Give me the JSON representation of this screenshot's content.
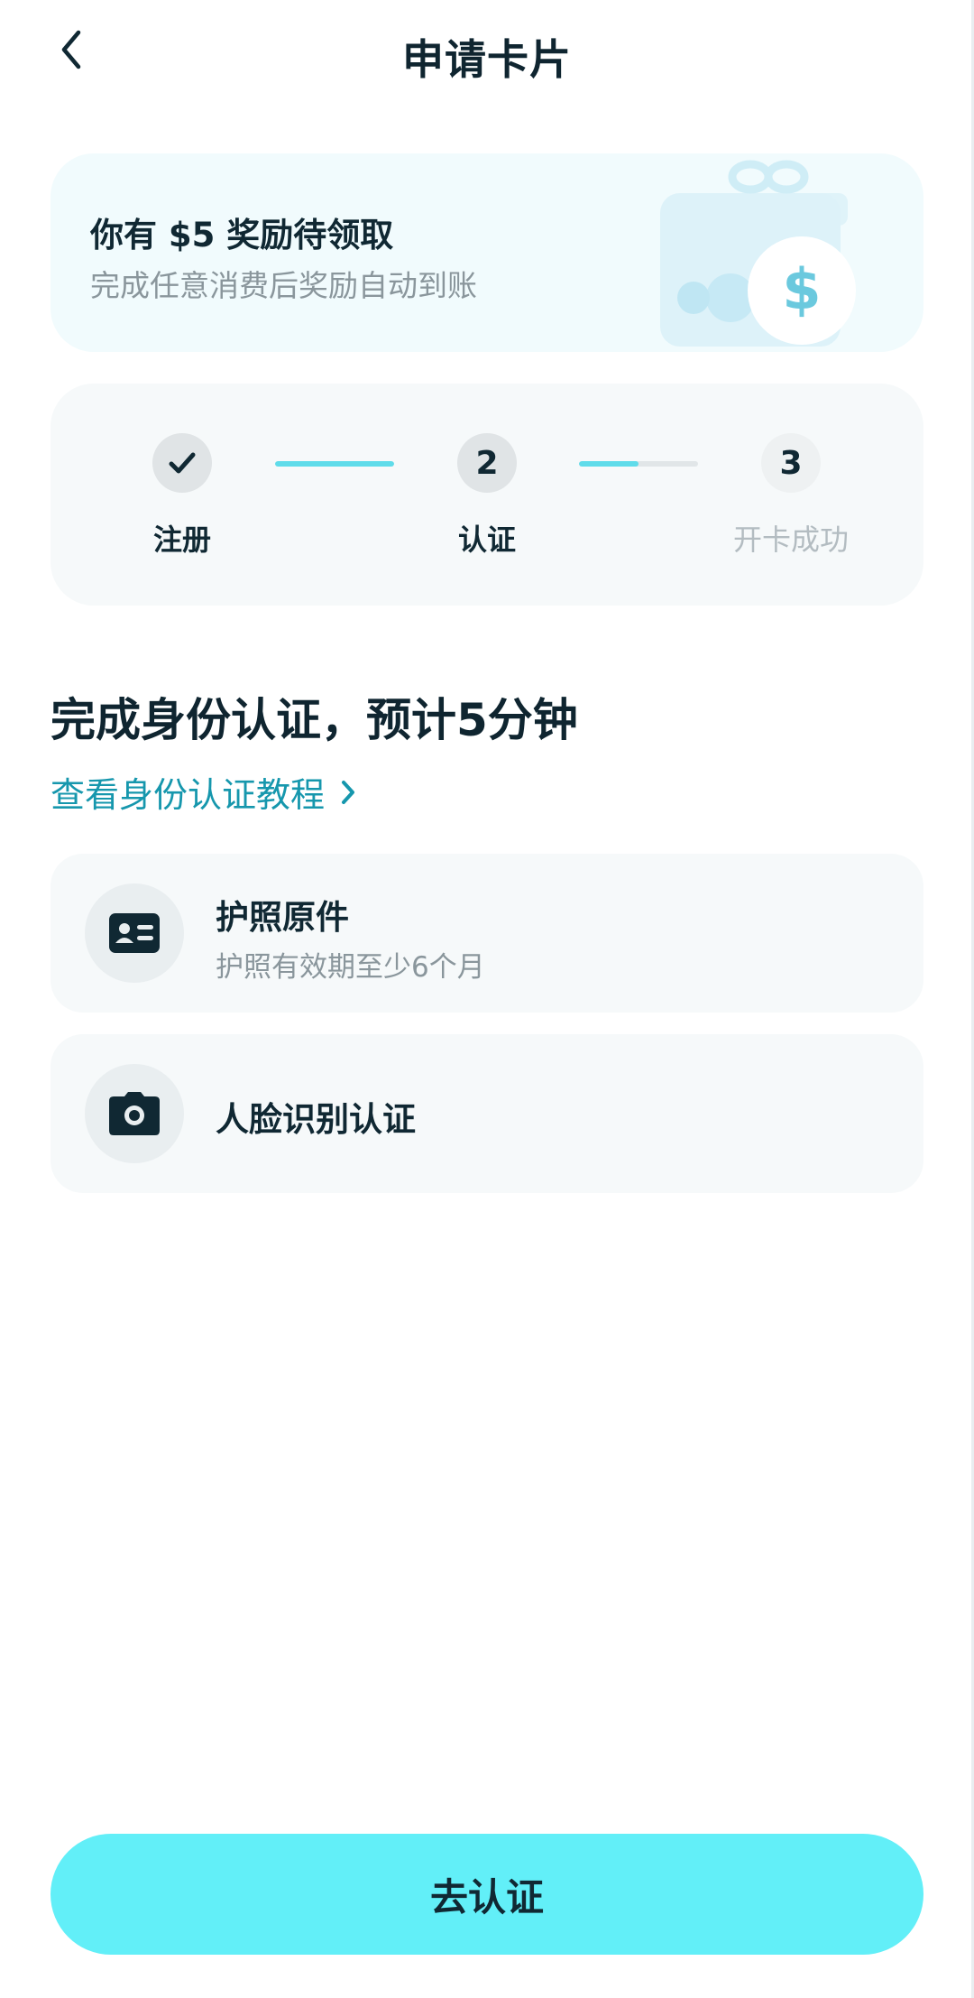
{
  "header": {
    "title": "申请卡片"
  },
  "reward": {
    "title": "你有 $5 奖励待领取",
    "subtitle": "完成任意消费后奖励自动到账",
    "coin_symbol": "$"
  },
  "steps": [
    {
      "number": "",
      "label": "注册",
      "status": "done"
    },
    {
      "number": "2",
      "label": "认证",
      "status": "current"
    },
    {
      "number": "3",
      "label": "开卡成功",
      "status": "pending"
    }
  ],
  "progress": {
    "line1_fraction": 1.0,
    "line2_fraction": 0.5
  },
  "section": {
    "title": "完成身份认证，预计5分钟",
    "tutorial_link": "查看身份认证教程"
  },
  "requirements": [
    {
      "title": "护照原件",
      "subtitle": "护照有效期至少6个月",
      "icon": "id-card-icon"
    },
    {
      "title": "人脸识别认证",
      "subtitle": "",
      "icon": "camera-icon"
    }
  ],
  "cta": {
    "label": "去认证"
  },
  "colors": {
    "accent": "#62eff8",
    "link": "#1697ad",
    "progress": "#5fdcea",
    "text_primary": "#0f2530",
    "text_secondary": "#8a969c"
  }
}
